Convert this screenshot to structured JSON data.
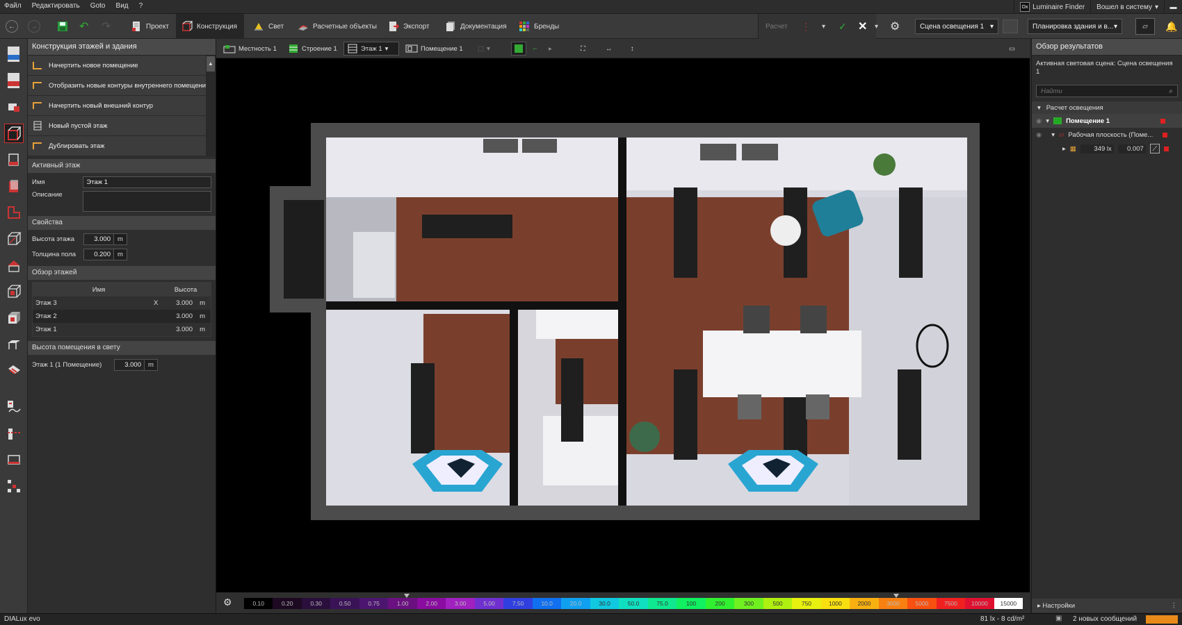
{
  "menu": [
    "Файл",
    "Редактировать",
    "Goto",
    "Вид",
    "?"
  ],
  "topright": {
    "luminaire_finder": "Luminaire Finder",
    "login": "Вошел в систему",
    "dialux_badge": "Dx"
  },
  "toolbar": {
    "tabs": [
      {
        "label": "Проект",
        "icon": "project-icon"
      },
      {
        "label": "Конструкция",
        "icon": "construction-icon"
      },
      {
        "label": "Свет",
        "icon": "light-icon"
      },
      {
        "label": "Расчетные объекты",
        "icon": "calc-objects-icon"
      },
      {
        "label": "Экспорт",
        "icon": "export-icon"
      },
      {
        "label": "Документация",
        "icon": "documentation-icon"
      },
      {
        "label": "Бренды",
        "icon": "brands-icon"
      }
    ],
    "calc_label": "Расчет",
    "scene_select": "Сцена освещения 1",
    "view_select": "Планировка здания и в..."
  },
  "left_panel": {
    "title": "Конструкция этажей и здания",
    "actions": [
      "Начертить новое помещение",
      "Отобразить новые контуры внутреннего помещения",
      "Начертить новый внешний контур",
      "Новый пустой этаж",
      "Дублировать этаж"
    ],
    "active_floor": {
      "header": "Активный этаж",
      "name_label": "Имя",
      "name_value": "Этаж 1",
      "desc_label": "Описание",
      "desc_value": ""
    },
    "properties": {
      "header": "Свойства",
      "height_label": "Высота этажа",
      "height_value": "3.000",
      "thickness_label": "Толщина пола",
      "thickness_value": "0.200",
      "unit": "m"
    },
    "floors_overview": {
      "header": "Обзор этажей",
      "col_name": "Имя",
      "col_height": "Высота",
      "rows": [
        {
          "name": "Этаж 3",
          "mark": "X",
          "height": "3.000",
          "unit": "m"
        },
        {
          "name": "Этаж 2",
          "mark": "",
          "height": "3.000",
          "unit": "m"
        },
        {
          "name": "Этаж 1",
          "mark": "",
          "height": "3.000",
          "unit": "m"
        }
      ]
    },
    "room_height": {
      "header": "Высота помещения в свету",
      "label": "Этаж 1 (1 Помещение)",
      "value": "3.000",
      "unit": "m"
    }
  },
  "view_toolbar": {
    "terrain": "Местность 1",
    "building": "Строение 1",
    "floor": "Этаж 1",
    "room": "Помещение 1"
  },
  "scale": {
    "labels": [
      "0.10",
      "0.20",
      "0.30",
      "0.50",
      "0.75",
      "1.00",
      "2.00",
      "3.00",
      "5.00",
      "7.50",
      "10.0",
      "20.0",
      "30.0",
      "50.0",
      "75.0",
      "100",
      "200",
      "300",
      "500",
      "750",
      "1000",
      "2000",
      "3000",
      "5000",
      "7500",
      "10000",
      "15000"
    ],
    "colors": [
      "#000000",
      "#1d0a22",
      "#2a0f3d",
      "#3a1357",
      "#4c1670",
      "#6a1080",
      "#8a0ca0",
      "#a020c0",
      "#7030d0",
      "#3040e0",
      "#1070f0",
      "#10a0f0",
      "#10c8e0",
      "#10e0c0",
      "#10e890",
      "#10f060",
      "#30f030",
      "#70f020",
      "#b0f010",
      "#e8f010",
      "#f8e010",
      "#f8b010",
      "#f88010",
      "#f85010",
      "#f02020",
      "#e01030",
      "#ffffff"
    ]
  },
  "right_panel": {
    "title": "Обзор результатов",
    "active_scene": "Активная световая сцена: Сцена освещения 1",
    "search_placeholder": "Найти",
    "tree": {
      "calc": "Расчет освещения",
      "room": "Помещение 1",
      "workplane": "Рабочая плоскость (Поме...",
      "lux": "349 lx",
      "ratio": "0.007"
    },
    "settings": "Настройки"
  },
  "status": {
    "brand": "DIALux evo",
    "luminance": "81 lx - 8 cd/m²",
    "messages": "2 новых сообщений"
  }
}
